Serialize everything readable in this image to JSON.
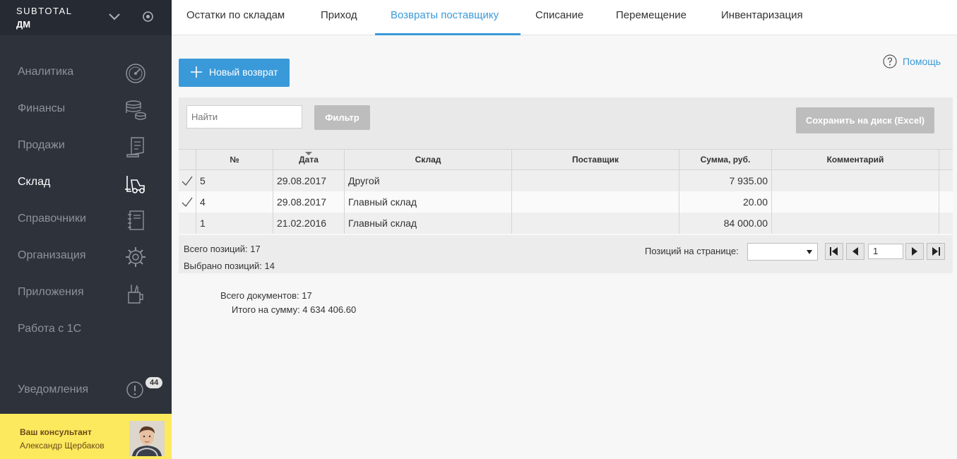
{
  "sidebar": {
    "brand": "SUBTOTAL",
    "brand_sub": "ДМ",
    "items": [
      {
        "label": "Аналитика",
        "icon": "speedometer-icon"
      },
      {
        "label": "Финансы",
        "icon": "coins-icon"
      },
      {
        "label": "Продажи",
        "icon": "receipt-icon"
      },
      {
        "label": "Склад",
        "icon": "forklift-icon",
        "active": true
      },
      {
        "label": "Справочники",
        "icon": "notebook-icon"
      },
      {
        "label": "Организация",
        "icon": "gear-icon"
      },
      {
        "label": "Приложения",
        "icon": "tools-cup-icon"
      },
      {
        "label": "Работа с 1С",
        "icon": ""
      }
    ],
    "notifications": {
      "label": "Уведомления",
      "count": "44"
    },
    "consultant": {
      "title": "Ваш консультант",
      "name": "Александр Щербаков"
    }
  },
  "tabs": [
    {
      "label": "Остатки по складам"
    },
    {
      "label": "Приход"
    },
    {
      "label": "Возвраты поставщику",
      "active": true
    },
    {
      "label": "Списание"
    },
    {
      "label": "Перемещение"
    },
    {
      "label": "Инвентаризация"
    }
  ],
  "toolbar": {
    "new_label": "Новый возврат",
    "help_label": "Помощь"
  },
  "filter": {
    "search_placeholder": "Найти",
    "filter_label": "Фильтр",
    "excel_label": "Сохранить на диск (Excel)"
  },
  "table": {
    "columns": [
      "№",
      "Дата",
      "Склад",
      "Поставщик",
      "Сумма, руб.",
      "Комментарий"
    ],
    "rows": [
      {
        "checked": true,
        "num": "5",
        "date": "29.08.2017",
        "warehouse": "Другой",
        "supplier": "",
        "sum": "7 935.00",
        "comment": ""
      },
      {
        "checked": true,
        "num": "4",
        "date": "29.08.2017",
        "warehouse": "Главный склад",
        "supplier": "",
        "sum": "20.00",
        "comment": ""
      },
      {
        "checked": false,
        "num": "1",
        "date": "21.02.2016",
        "warehouse": "Главный склад",
        "supplier": "",
        "sum": "84 000.00",
        "comment": ""
      }
    ]
  },
  "footer": {
    "total_positions": "Всего позиций: 17",
    "selected_positions": "Выбрано позиций: 14",
    "per_page_label": "Позиций на странице:",
    "page": "1"
  },
  "summary": {
    "docs": "Всего документов: 17",
    "total_sum": "Итого на сумму: 4 634 406.60"
  },
  "colors": {
    "accent": "#3a9ad9",
    "sidebar": "#2e323b",
    "consultant_bg": "#fde95d"
  }
}
